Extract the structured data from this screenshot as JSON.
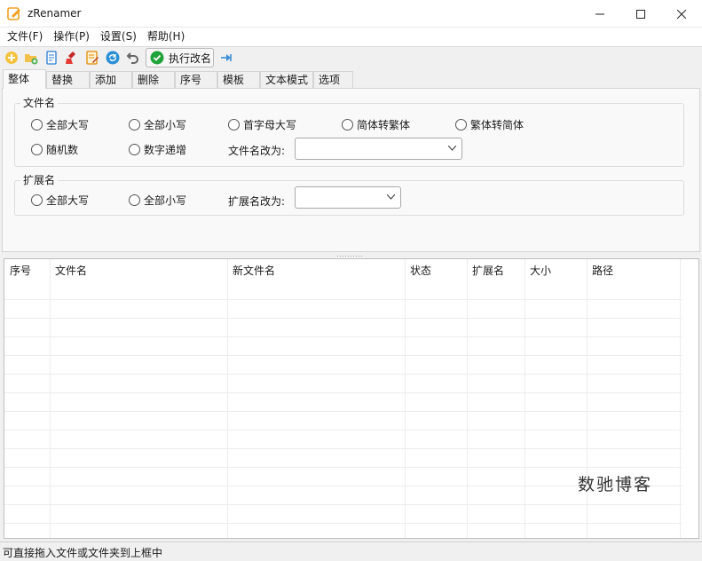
{
  "window": {
    "title": "zRenamer"
  },
  "menu": [
    "文件(F)",
    "操作(P)",
    "设置(S)",
    "帮助(H)"
  ],
  "toolbar": {
    "execute_label": "执行改名",
    "icons": [
      "add-icon",
      "add-folder-icon",
      "document-icon",
      "clear-icon",
      "edit-list-icon",
      "refresh-icon",
      "undo-icon",
      "execute-check-icon",
      "pin-icon"
    ]
  },
  "tabs": [
    "整体",
    "替换",
    "添加",
    "删除",
    "序号",
    "模板",
    "文本模式",
    "选项"
  ],
  "filename_group": {
    "title": "文件名",
    "options": [
      "全部大写",
      "全部小写",
      "首字母大写",
      "简体转繁体",
      "繁体转简体",
      "随机数",
      "数字递增"
    ],
    "rename_to_label": "文件名改为:",
    "rename_to_value": ""
  },
  "extension_group": {
    "title": "扩展名",
    "options": [
      "全部大写",
      "全部小写"
    ],
    "rename_to_label": "扩展名改为:",
    "rename_to_value": ""
  },
  "table": {
    "columns": [
      "序号",
      "文件名",
      "新文件名",
      "状态",
      "扩展名",
      "大小",
      "路径"
    ],
    "rows": []
  },
  "watermark": "数驰博客",
  "status": "可直接拖入文件或文件夹到上框中"
}
